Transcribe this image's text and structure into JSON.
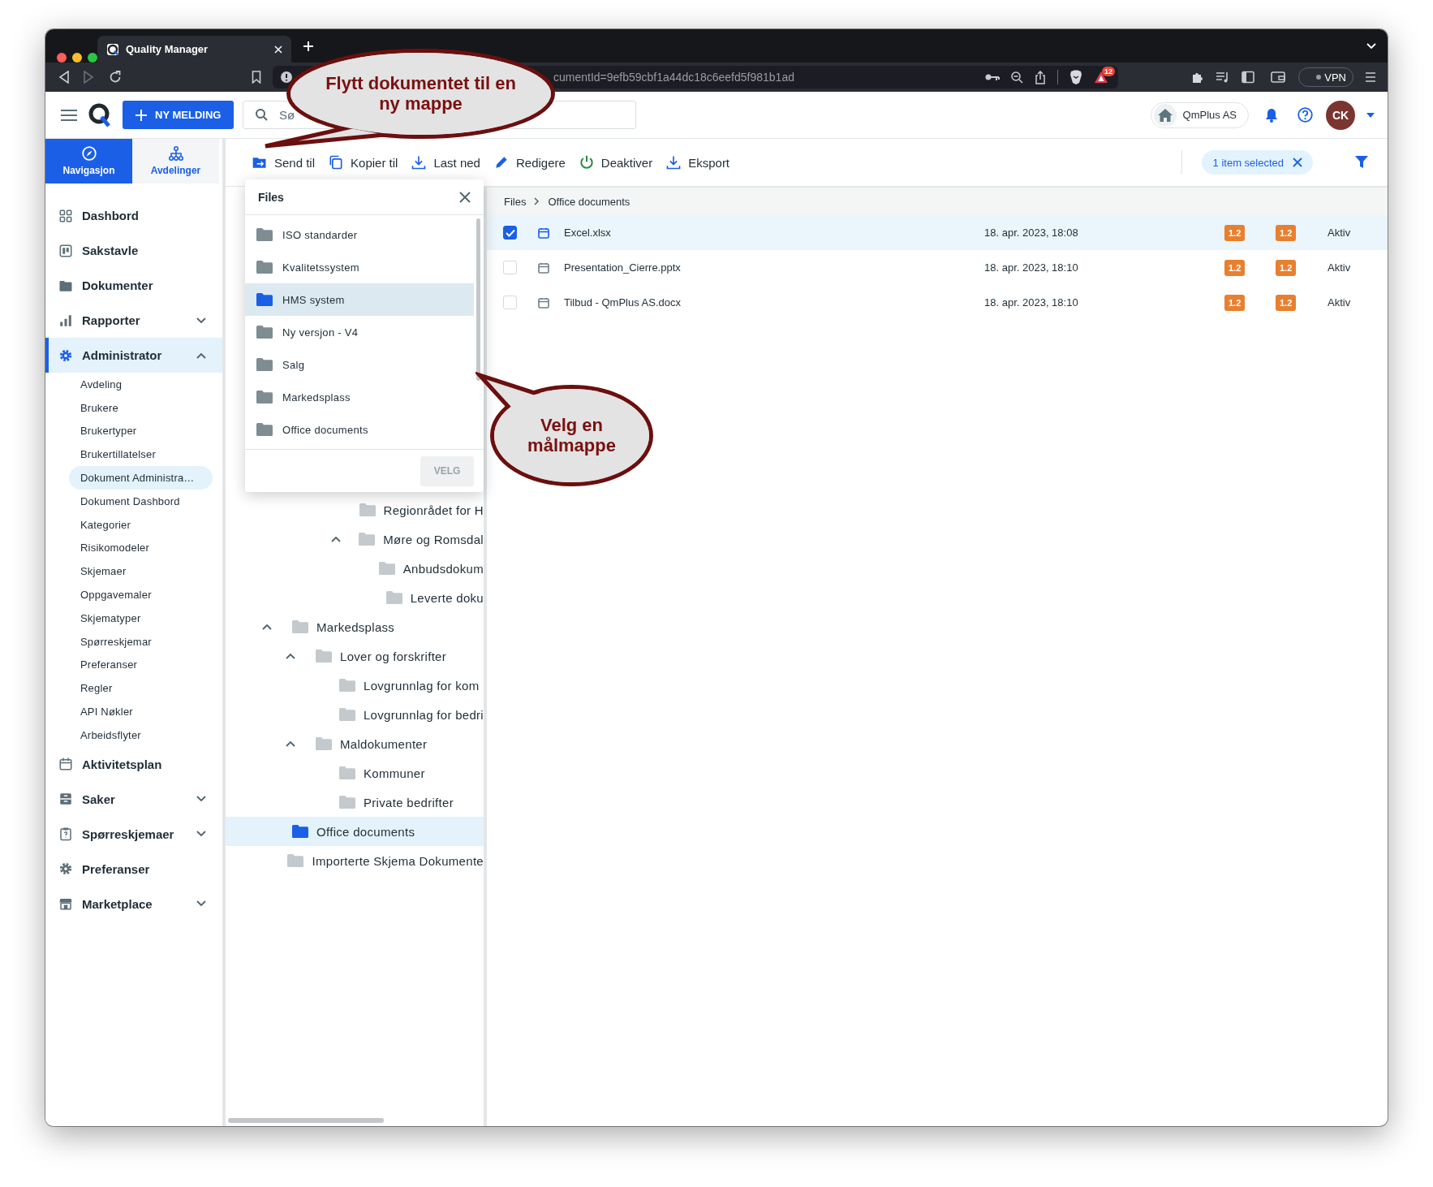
{
  "browser": {
    "tab_title": "Quality Manager",
    "url": "cumentId=9efb59cbf1a44dc18c6eefd5f981b1ad",
    "notification_badge": "12",
    "vpn_label": "VPN"
  },
  "header": {
    "new_button": "NY MELDING",
    "search": {
      "placeholder": "Sø"
    },
    "company": "QmPlus AS",
    "avatar_initials": "CK"
  },
  "sidebar": {
    "tabs": [
      {
        "label": "Navigasjon",
        "selected": true
      },
      {
        "label": "Avdelinger",
        "selected": false
      }
    ],
    "items": [
      {
        "label": "Dashbord",
        "selected": false
      },
      {
        "label": "Sakstavle",
        "selected": false
      },
      {
        "label": "Dokumenter",
        "selected": false
      },
      {
        "label": "Rapporter",
        "selected": false,
        "expanded": false
      },
      {
        "label": "Administrator",
        "selected": true,
        "expanded": true,
        "children": [
          {
            "label": "Avdeling",
            "selected": false
          },
          {
            "label": "Brukere",
            "selected": false
          },
          {
            "label": "Brukertyper",
            "selected": false
          },
          {
            "label": "Brukertillatelser",
            "selected": false
          },
          {
            "label": "Dokument Administra…",
            "selected": true
          },
          {
            "label": "Dokument Dashbord",
            "selected": false
          },
          {
            "label": "Kategorier",
            "selected": false
          },
          {
            "label": "Risikomodeler",
            "selected": false
          },
          {
            "label": "Skjemaer",
            "selected": false
          },
          {
            "label": "Oppgavemaler",
            "selected": false
          },
          {
            "label": "Skjematyper",
            "selected": false
          },
          {
            "label": "Spørreskjemar",
            "selected": false
          },
          {
            "label": "Preferanser",
            "selected": false
          },
          {
            "label": "Regler",
            "selected": false
          },
          {
            "label": "API Nøkler",
            "selected": false
          },
          {
            "label": "Arbeidsflyter",
            "selected": false
          }
        ]
      },
      {
        "label": "Aktivitetsplan",
        "selected": false
      },
      {
        "label": "Saker",
        "selected": false,
        "expanded": false
      },
      {
        "label": "Spørreskjemaer",
        "selected": false,
        "expanded": false
      },
      {
        "label": "Preferanser",
        "selected": false
      },
      {
        "label": "Marketplace",
        "selected": false,
        "expanded": false
      }
    ]
  },
  "toolbar": {
    "actions": [
      "Send til",
      "Kopier til",
      "Last ned",
      "Redigere",
      "Deaktiver",
      "Eksport"
    ],
    "selection_chip": "1 item selected"
  },
  "picker_dialog": {
    "title": "Files",
    "folders": [
      {
        "label": "ISO standarder",
        "selected": false
      },
      {
        "label": "Kvalitetssystem",
        "selected": false
      },
      {
        "label": "HMS system",
        "selected": true
      },
      {
        "label": "Ny versjon - V4",
        "selected": false
      },
      {
        "label": "Salg",
        "selected": false
      },
      {
        "label": "Markedsplass",
        "selected": false
      },
      {
        "label": "Office documents",
        "selected": false
      }
    ],
    "confirm_button": {
      "label": "VELG",
      "disabled": true
    }
  },
  "folder_tree": [
    {
      "children": [
        {
          "children": [
            {
              "children": [
                {
                  "label": "Regionrådet for H",
                  "selected": false
                },
                {
                  "label": "Møre og Romsdal",
                  "selected": false,
                  "expanded": true,
                  "children": [
                    {
                      "label": "Anbudsdokum",
                      "selected": false
                    },
                    {
                      "label": "Leverte doku",
                      "selected": false
                    }
                  ]
                }
              ]
            }
          ]
        }
      ]
    },
    {
      "label": "Markedsplass",
      "selected": false,
      "expanded": true,
      "children": [
        {
          "label": "Lover og forskrifter",
          "selected": false,
          "expanded": true,
          "children": [
            {
              "label": "Lovgrunnlag for kom",
              "selected": false
            },
            {
              "label": "Lovgrunnlag for bedri",
              "selected": false
            }
          ]
        },
        {
          "label": "Maldokumenter",
          "selected": false,
          "expanded": true,
          "children": [
            {
              "label": "Kommuner",
              "selected": false
            },
            {
              "label": "Private bedrifter",
              "selected": false
            }
          ]
        }
      ]
    },
    {
      "label": "Office documents",
      "selected": true
    },
    {
      "label": "Importerte Skjema Dokumente",
      "selected": false
    }
  ],
  "breadcrumb": [
    "Files",
    "Office documents"
  ],
  "files": [
    {
      "name": "Excel.xlsx",
      "date": "18. apr. 2023, 18:08",
      "column_4": "1.2",
      "column_5": "1.2",
      "status": "Aktiv",
      "selected": true
    },
    {
      "name": "Presentation_Cierre.pptx",
      "date": "18. apr. 2023, 18:10",
      "column_4": "1.2",
      "column_5": "1.2",
      "status": "Aktiv",
      "selected": false
    },
    {
      "name": "Tilbud - QmPlus AS.docx",
      "date": "18. apr. 2023, 18:10",
      "column_4": "1.2",
      "column_5": "1.2",
      "status": "Aktiv",
      "selected": false
    }
  ],
  "callouts": [
    {
      "text": "Flytt dokumentet til en ny mappe"
    },
    {
      "text": "Velg en målmappe"
    }
  ]
}
